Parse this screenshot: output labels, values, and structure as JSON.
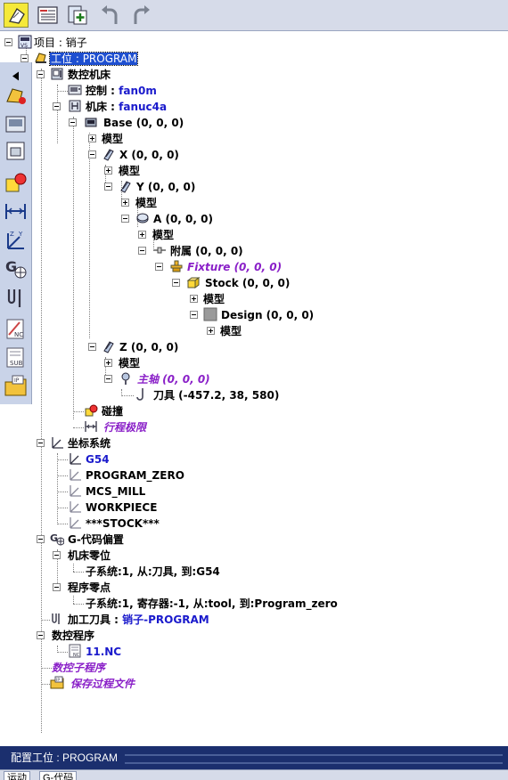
{
  "toolbar": {
    "buttons": [
      {
        "name": "select-pointer-icon",
        "active": true
      },
      {
        "name": "properties-icon",
        "active": false
      },
      {
        "name": "add-component-icon",
        "active": false
      },
      {
        "name": "undo-icon",
        "active": false
      },
      {
        "name": "redo-icon",
        "active": false
      }
    ]
  },
  "sidebar": {
    "buttons": [
      "collapse-arrow-icon",
      "workstation-icon",
      "machine-icon",
      "fixture-icon",
      "collision-icon",
      "travel-limit-icon",
      "coordinate-system-icon",
      "g-code-offset-icon",
      "tool-icon",
      "nc-program-icon",
      "subroutine-icon",
      "save-ip-icon"
    ]
  },
  "tree": {
    "project_label": "项目 : ",
    "project_value": "销子",
    "workstation_label": "工位 : ",
    "workstation_value": "PROGRAM",
    "cnc_machine": "数控机床",
    "control_label": "控制 : ",
    "control_value": "fan0m",
    "machine_label": "机床 : ",
    "machine_value": "fanuc4a",
    "base": "Base (0, 0, 0)",
    "model": "模型",
    "x_axis": "X (0, 0, 0)",
    "y_axis": "Y (0, 0, 0)",
    "a_axis": "A (0, 0, 0)",
    "attach": "附属 (0, 0, 0)",
    "fixture": "Fixture (0, 0, 0)",
    "stock": "Stock (0, 0, 0)",
    "design": "Design (0, 0, 0)",
    "z_axis": "Z (0, 0, 0)",
    "spindle": "主轴 (0, 0, 0)",
    "tool": "刀具 (-457.2, 38, 580)",
    "collision": "碰撞",
    "travel_limits": "行程极限",
    "coord_systems": "坐标系统",
    "cs_g54": "G54",
    "cs_program_zero": "PROGRAM_ZERO",
    "cs_mcs_mill": "MCS_MILL",
    "cs_workpiece": "WORKPIECE",
    "cs_stock": "***STOCK***",
    "gcode_offsets": "G-代码偏置",
    "machine_zero": "机床零位",
    "machine_zero_sub": "子系统:1, 从:刀具, 到:G54",
    "program_zero": "程序零点",
    "program_zero_sub": "子系统:1, 寄存器:-1, 从:tool, 到:Program_zero",
    "machining_tool_label": "加工刀具 : ",
    "machining_tool_value": "销子-PROGRAM",
    "nc_programs": "数控程序",
    "nc_file": "11.NC",
    "nc_subroutines": "数控子程序",
    "save_process_file": "保存过程文件"
  },
  "status": {
    "text": "配置工位 : PROGRAM"
  },
  "tabs": [
    "运动",
    "G-代码"
  ]
}
